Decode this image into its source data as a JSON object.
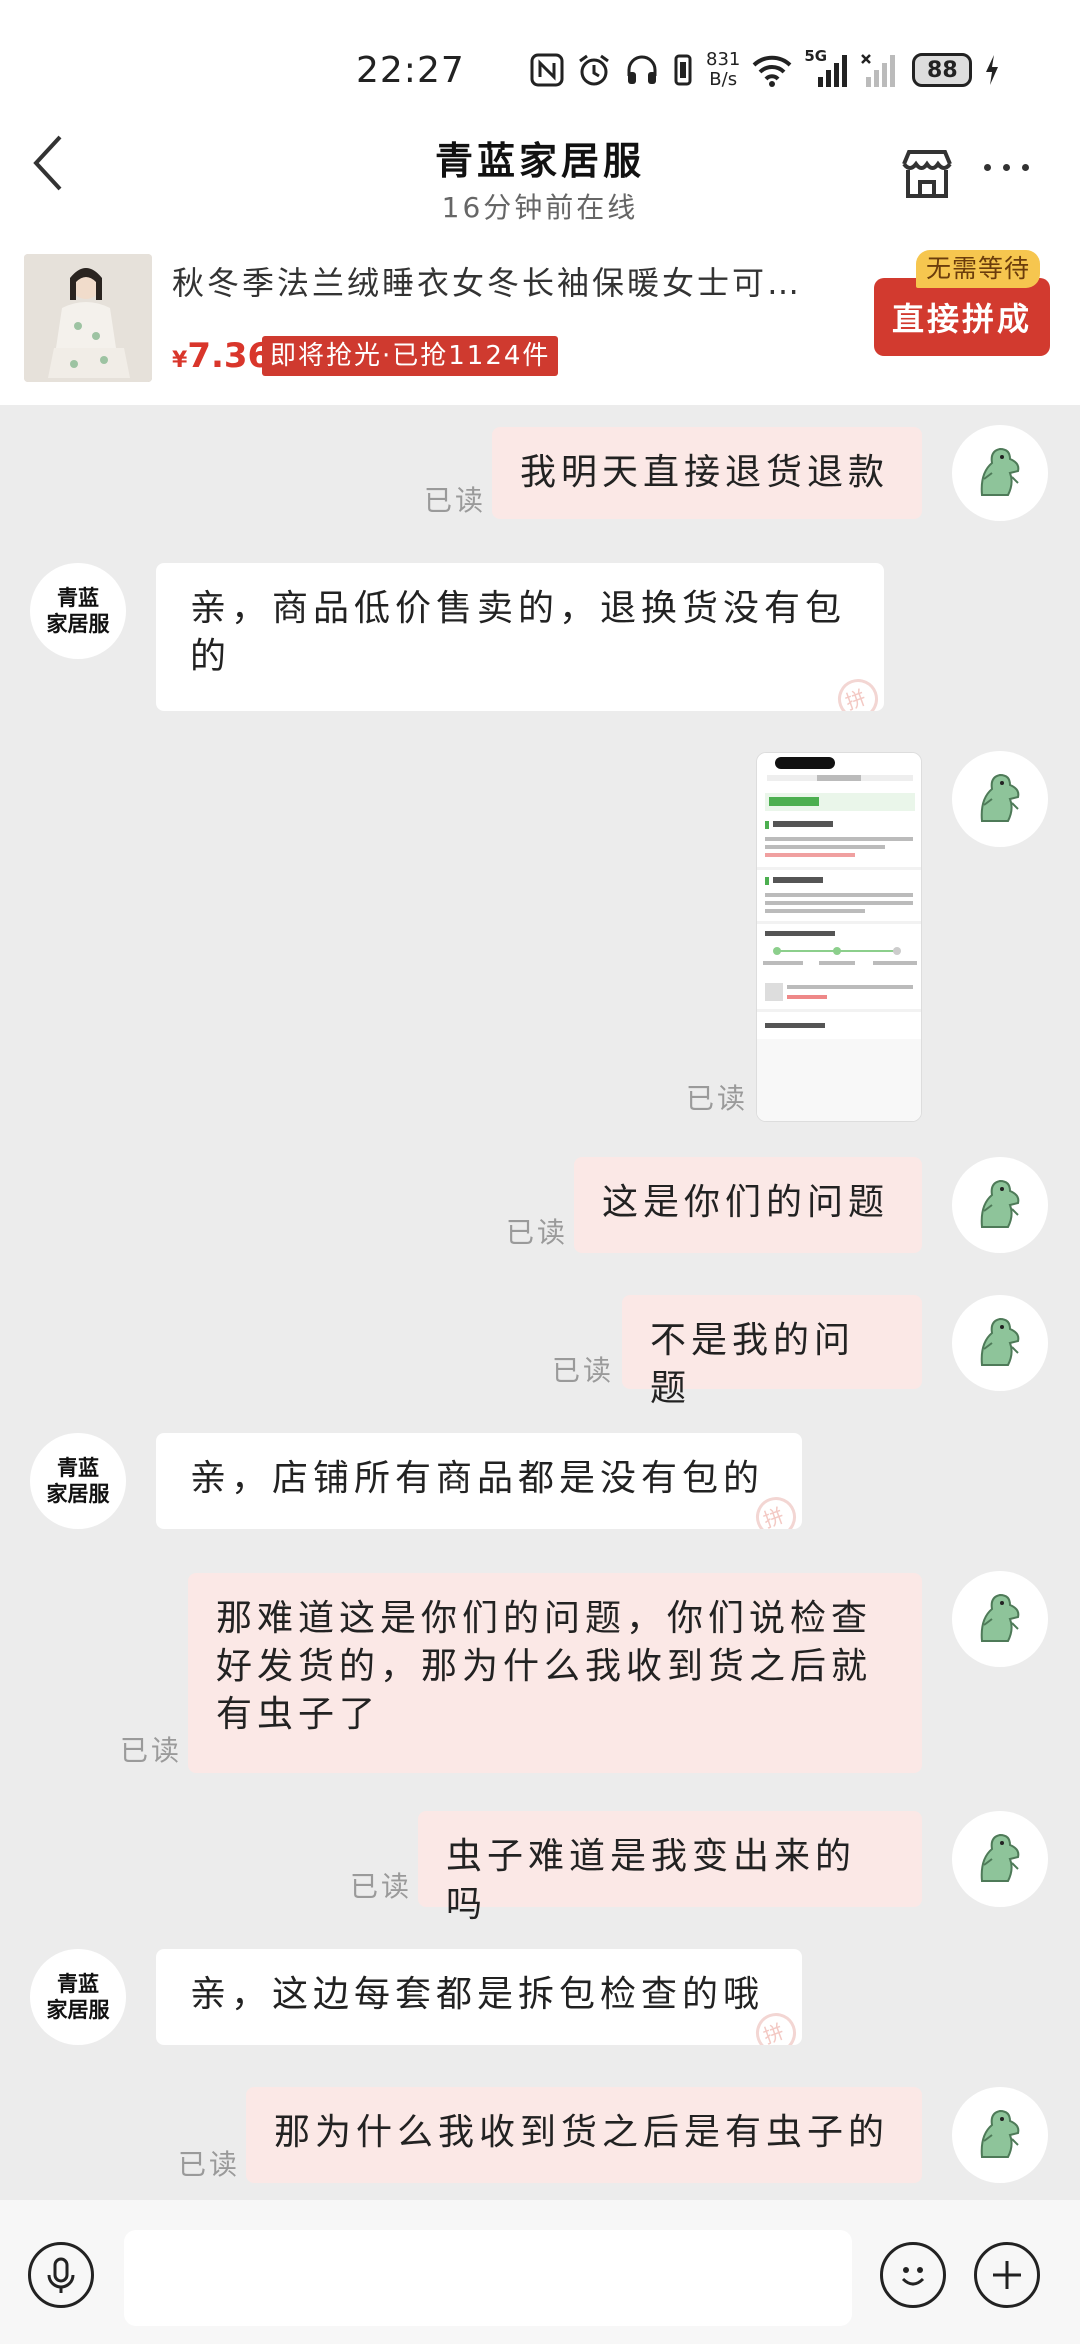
{
  "status_bar": {
    "time": "22:27",
    "net_speed_value": "831",
    "net_speed_unit": "B/s",
    "network": "5G",
    "battery": "88",
    "icons": [
      "nfc-icon",
      "alarm-icon",
      "headphones-icon",
      "vibrate-icon",
      "wifi-icon",
      "signal-icon",
      "no-signal-icon",
      "battery-icon",
      "charging-icon"
    ]
  },
  "header": {
    "title": "青蓝家居服",
    "subtitle": "16分钟前在线",
    "icons": [
      "back-icon",
      "store-icon",
      "more-icon"
    ]
  },
  "product": {
    "title": "秋冬季法兰绒睡衣女冬长袖保暖女士可…",
    "price_symbol": "¥",
    "price": "7.36",
    "tag": "即将抢光·已抢1124件",
    "badge": "无需等待",
    "button": "直接拼成"
  },
  "shop_avatar": {
    "line1": "青蓝",
    "line2": "家居服"
  },
  "read_label": "已读",
  "messages": [
    {
      "from": "me",
      "text": "我明天直接退货退款"
    },
    {
      "from": "shop",
      "text": "亲，商品低价售卖的，退换货没有包的"
    },
    {
      "from": "me",
      "type": "image"
    },
    {
      "from": "me",
      "text": "这是你们的问题"
    },
    {
      "from": "me",
      "text": "不是我的问题"
    },
    {
      "from": "shop",
      "text": "亲，店铺所有商品都是没有包的"
    },
    {
      "from": "me",
      "text": "那难道这是你们的问题，你们说检查好发货的，那为什么我收到货之后就有虫子了"
    },
    {
      "from": "me",
      "text": "虫子难道是我变出来的吗"
    },
    {
      "from": "shop",
      "text": "亲，这边每套都是拆包检查的哦"
    },
    {
      "from": "me",
      "text": "那为什么我收到货之后是有虫子的"
    }
  ],
  "input_bar": {
    "placeholder": "",
    "icons": [
      "voice-icon",
      "emoji-icon",
      "plus-icon"
    ]
  },
  "colors": {
    "outgoing_bubble": "#fbe8e6",
    "incoming_bubble": "#ffffff",
    "chat_background": "#ececec",
    "accent_red": "#d23a2f",
    "badge_yellow": "#f6c64f",
    "avatar_green": "#8ec49a"
  }
}
